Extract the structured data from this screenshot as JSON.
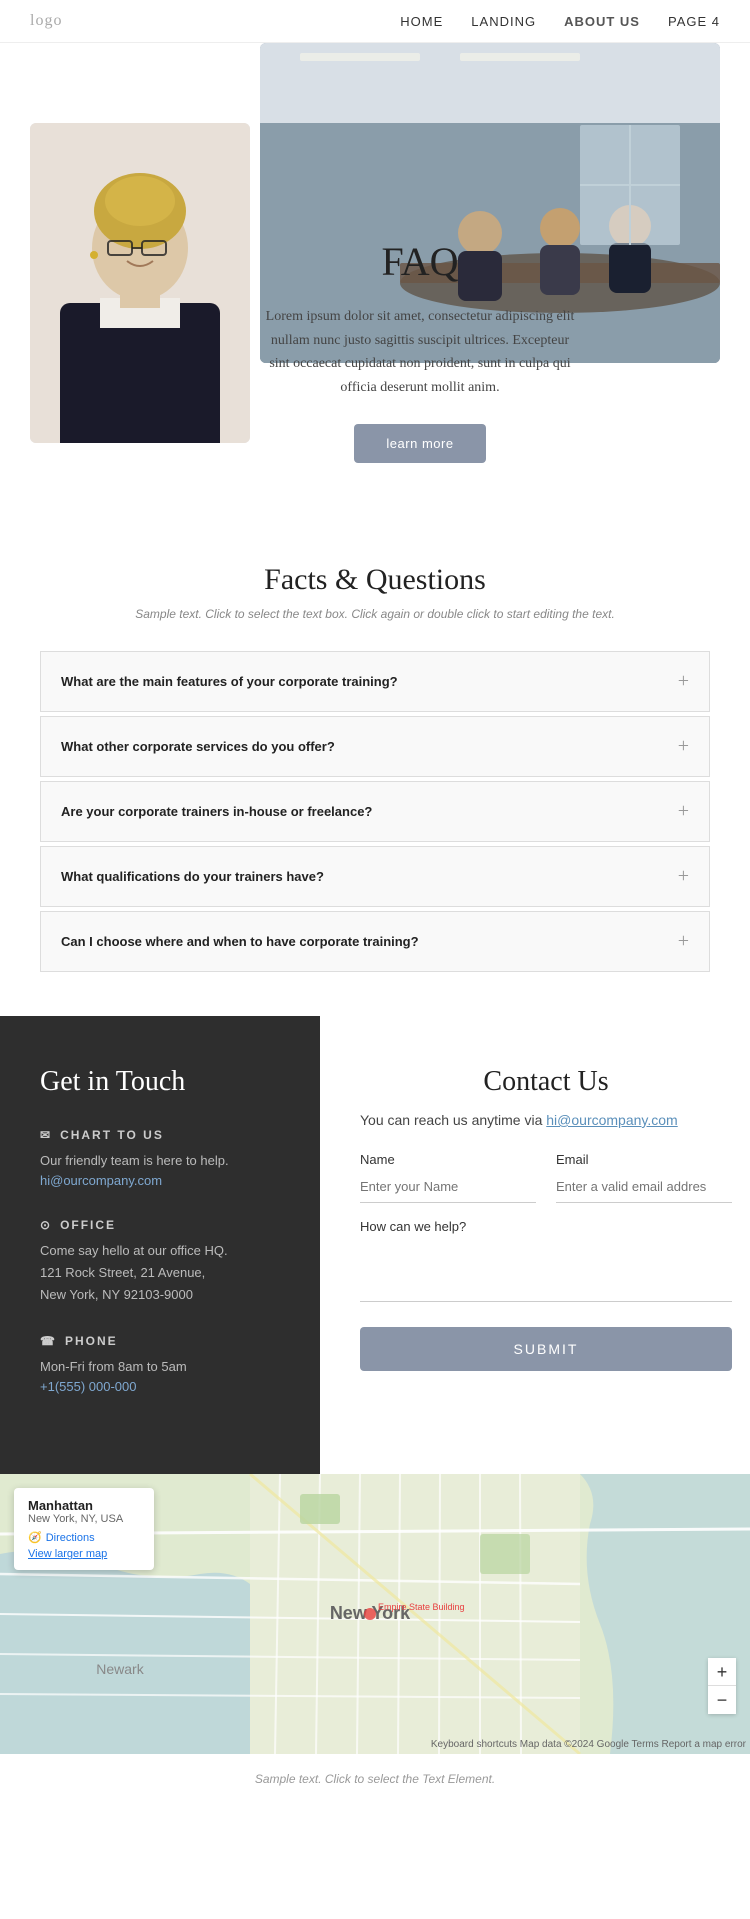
{
  "nav": {
    "logo": "logo",
    "links": [
      {
        "label": "HOME",
        "active": false
      },
      {
        "label": "LANDING",
        "active": false
      },
      {
        "label": "ABOUT US",
        "active": true
      },
      {
        "label": "PAGE 4",
        "active": false
      }
    ]
  },
  "hero": {
    "title": "FAQ",
    "body": "Lorem ipsum dolor sit amet, consectetur adipiscing elit nullam nunc justo sagittis suscipit ultrices. Excepteur sint occaecat cupidatat non proident, sunt in culpa qui officia deserunt mollit anim.",
    "button": "learn more"
  },
  "faq_section": {
    "title": "Facts & Questions",
    "subtitle": "Sample text. Click to select the text box. Click again or double click to start editing the text.",
    "items": [
      {
        "question": "What are the main features of your corporate training?"
      },
      {
        "question": "What other corporate services do you offer?"
      },
      {
        "question": "Are your corporate trainers in-house or freelance?"
      },
      {
        "question": "What qualifications do your trainers have?"
      },
      {
        "question": "Can I choose where and when to have corporate training?"
      }
    ]
  },
  "contact_left": {
    "title": "Get in Touch",
    "chart_title": "CHART TO US",
    "chart_desc": "Our friendly team is here to help.",
    "chart_email": "hi@ourcompany.com",
    "office_title": "OFFICE",
    "office_desc": "Come say hello at our office HQ.",
    "office_addr1": "121 Rock Street, 21 Avenue,",
    "office_addr2": "New York, NY 92103-9000",
    "phone_title": "PHONE",
    "phone_hours": "Mon-Fri from 8am to 5am",
    "phone_number": "+1(555) 000-000"
  },
  "contact_right": {
    "title": "Contact Us",
    "intro": "You can reach us anytime via",
    "email_link": "hi@ourcompany.com",
    "name_label": "Name",
    "name_placeholder": "Enter your Name",
    "email_label": "Email",
    "email_placeholder": "Enter a valid email addres",
    "how_help_label": "How can we help?",
    "submit_button": "SUBMIT"
  },
  "map": {
    "place_name": "Manhattan",
    "place_addr": "New York, NY, USA",
    "directions": "Directions",
    "larger_map": "View larger map",
    "attribution": "Keyboard shortcuts  Map data ©2024 Google  Terms  Report a map error"
  },
  "footer": {
    "sample_text": "Sample text. Click to select the Text Element."
  }
}
